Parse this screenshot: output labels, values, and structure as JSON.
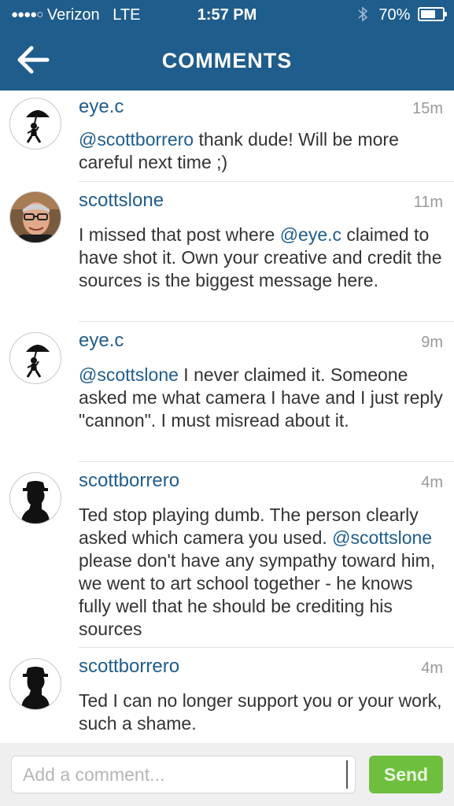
{
  "status_bar": {
    "signal": "●●●●○",
    "carrier": "Verizon",
    "network": "LTE",
    "time": "1:57 PM",
    "bluetooth_icon": "bluetooth-icon",
    "battery_text": "70%",
    "battery_level": 0.7
  },
  "header": {
    "title": "COMMENTS",
    "back_icon": "back-arrow-icon"
  },
  "comments": [
    {
      "username": "eye.c",
      "time": "15m",
      "avatar": "umbrella-figure-avatar",
      "parts": [
        {
          "text": "@scottborrero",
          "mention": true
        },
        {
          "text": " thank dude! Will be more careful next time ;)",
          "mention": false
        }
      ]
    },
    {
      "username": "scottslone",
      "time": "11m",
      "avatar": "photo-avatar",
      "parts": [
        {
          "text": "I missed that post where ",
          "mention": false
        },
        {
          "text": "@eye.c",
          "mention": true
        },
        {
          "text": " claimed to have shot it. Own your creative and credit the sources is the biggest message here.",
          "mention": false
        }
      ]
    },
    {
      "username": "eye.c",
      "time": "9m",
      "avatar": "umbrella-figure-avatar",
      "parts": [
        {
          "text": "@scottslone",
          "mention": true
        },
        {
          "text": " I never claimed it. Someone asked me what camera I have and I just reply \"cannon\". I must misread about it.",
          "mention": false
        }
      ]
    },
    {
      "username": "scottborrero",
      "time": "4m",
      "avatar": "hat-silhouette-avatar",
      "parts": [
        {
          "text": "Ted stop playing dumb. The person clearly asked which camera you used. ",
          "mention": false
        },
        {
          "text": "@scottslone",
          "mention": true
        },
        {
          "text": " please don't have any sympathy toward him, we went to art school together - he knows fully well that he should be crediting his sources",
          "mention": false
        }
      ]
    },
    {
      "username": "scottborrero",
      "time": "4m",
      "avatar": "hat-silhouette-avatar",
      "parts": [
        {
          "text": "Ted I can no longer support you or your work, such a shame.",
          "mention": false
        }
      ]
    }
  ],
  "composer": {
    "placeholder": "Add a comment...",
    "value": "",
    "send_label": "Send"
  },
  "colors": {
    "brand": "#1f5d8c",
    "send_button": "#6fbf3f",
    "timestamp": "#999999"
  }
}
